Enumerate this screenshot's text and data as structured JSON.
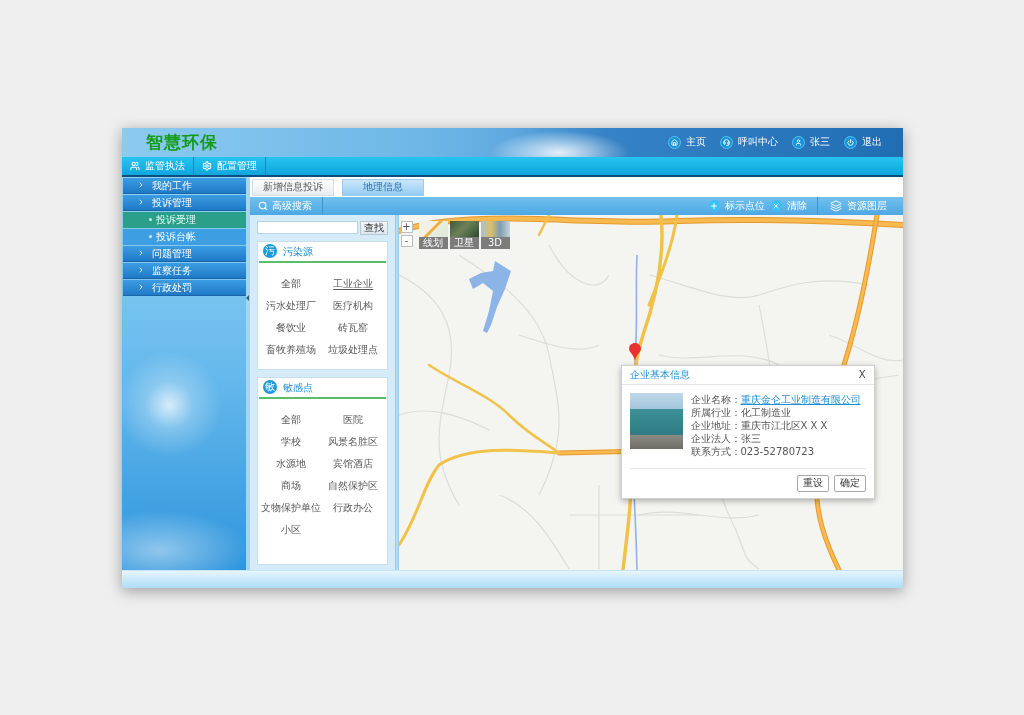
{
  "header": {
    "logo": "智慧环保",
    "links": [
      {
        "kind": "home",
        "label": "主页"
      },
      {
        "kind": "headset",
        "label": "呼叫中心"
      },
      {
        "kind": "user",
        "label": "张三"
      },
      {
        "kind": "power",
        "label": "退出"
      }
    ]
  },
  "nav_tabs": [
    {
      "kind": "users",
      "label": "监管执法"
    },
    {
      "kind": "gear",
      "label": "配置管理"
    }
  ],
  "sidebar": {
    "items": [
      {
        "label": "我的工作"
      },
      {
        "label": "投诉管理",
        "children": [
          {
            "label": "投诉受理",
            "selected": true
          },
          {
            "label": "投诉台帐",
            "selected": false
          }
        ]
      },
      {
        "label": "问题管理"
      },
      {
        "label": "监察任务"
      },
      {
        "label": "行政处罚"
      }
    ]
  },
  "content_tabs": [
    {
      "label": "新增信息投诉",
      "selected": false
    },
    {
      "label": "地理信息",
      "selected": true
    }
  ],
  "toolbar": {
    "search_button": "高级搜索",
    "actions": [
      {
        "kind": "add",
        "label": "标示点位"
      },
      {
        "kind": "clear",
        "label": "清除"
      },
      {
        "kind": "layers",
        "label": "资源图层"
      }
    ]
  },
  "filter_panel": {
    "search_button": "查找",
    "categories": [
      {
        "badge": "污",
        "title": "污染源",
        "items": [
          {
            "label": "全部",
            "selected": false
          },
          {
            "label": "工业企业",
            "selected": true
          },
          {
            "label": "污水处理厂",
            "selected": false
          },
          {
            "label": "医疗机构",
            "selected": false
          },
          {
            "label": "餐饮业",
            "selected": false
          },
          {
            "label": "砖瓦窑",
            "selected": false
          },
          {
            "label": "畜牧养殖场",
            "selected": false
          },
          {
            "label": "垃圾处理点",
            "selected": false
          }
        ]
      },
      {
        "badge": "敏",
        "title": "敏感点",
        "items": [
          {
            "label": "全部",
            "selected": false
          },
          {
            "label": "医院",
            "selected": false
          },
          {
            "label": "学校",
            "selected": false
          },
          {
            "label": "风景名胜区",
            "selected": false
          },
          {
            "label": "水源地",
            "selected": false
          },
          {
            "label": "宾馆酒店",
            "selected": false
          },
          {
            "label": "商场",
            "selected": false
          },
          {
            "label": "自然保护区",
            "selected": false
          },
          {
            "label": "文物保护单位",
            "selected": false
          },
          {
            "label": "行政办公",
            "selected": false
          },
          {
            "label": "小区",
            "selected": false
          }
        ]
      }
    ]
  },
  "map": {
    "zoom_controls": [
      "+",
      "-"
    ],
    "layer_buttons": [
      {
        "kind": "street",
        "label": "线划"
      },
      {
        "kind": "satellite",
        "label": "卫星"
      },
      {
        "kind": "buildings",
        "label": "3D"
      }
    ],
    "popup": {
      "title": "企业基本信息",
      "close": "X",
      "fields": [
        {
          "kind": "link",
          "label": "企业名称：",
          "value": "重庆金仑工业制造有限公司"
        },
        {
          "kind": "text",
          "label": "所属行业：",
          "value": "化工制造业"
        },
        {
          "kind": "text",
          "label": "企业地址：",
          "value": "重庆市江北区X X X"
        },
        {
          "kind": "text",
          "label": "企业法人：",
          "value": "张三"
        },
        {
          "kind": "text",
          "label": "联系方式：",
          "value": "023-52780723"
        }
      ],
      "buttons": [
        "重设",
        "确定"
      ]
    }
  }
}
